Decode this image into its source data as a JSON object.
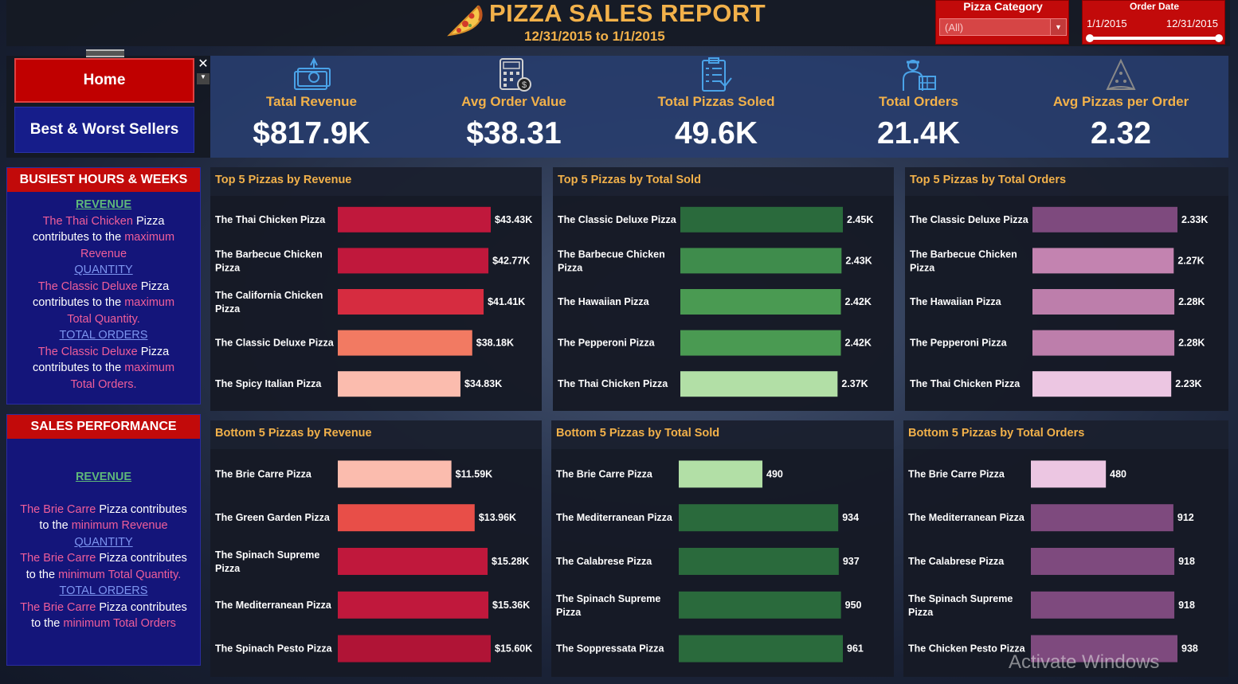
{
  "header": {
    "title": "PIZZA SALES REPORT",
    "subtitle": "12/31/2015 to 1/1/2015",
    "pizza_icon": "pizza-slice-icon"
  },
  "filters": {
    "category": {
      "label": "Pizza Category",
      "value": "(All)"
    },
    "order_date": {
      "label": "Order Date",
      "start": "1/1/2015",
      "end": "12/31/2015"
    }
  },
  "nav": {
    "home_label": "Home",
    "best_worst_label": "Best & Worst Sellers",
    "close_glyph": "✕",
    "more_glyph": "▼"
  },
  "kpis": [
    {
      "label": "Tatal Revenue",
      "value": "$817.9K",
      "icon": "money-icon"
    },
    {
      "label": "Avg Order Value",
      "value": "$38.31",
      "icon": "calculator-icon"
    },
    {
      "label": "Total Pizzas Soled",
      "value": "49.6K",
      "icon": "clipboard-icon"
    },
    {
      "label": "Total Orders",
      "value": "21.4K",
      "icon": "delivery-person-icon"
    },
    {
      "label": "Avg Pizzas per Order",
      "value": "2.32",
      "icon": "pizza-slice-icon"
    }
  ],
  "busiest": {
    "header": "BUSIEST HOURS & WEEKS",
    "revenue_head": "REVENUE",
    "rev_name": "The Thai Chicken",
    "rev_pizza": " Pizza",
    "contributes": "contributes to the",
    "maximum": "maximum",
    "revenue_word": "Revenue",
    "quantity_head": "QUANTITY",
    "qty_name": "The Classic Deluxe",
    "qty_pizza": " Pizza",
    "total_quantity": "Total Quantity.",
    "orders_head": "TOTAL ORDERS",
    "ord_name": "The Classic Deluxe",
    "ord_pizza": " Pizza",
    "total_orders": "Total Orders."
  },
  "sales_perf": {
    "header": "SALES PERFORMANCE",
    "revenue_head": "REVENUE",
    "l1a": "The Brie Carre",
    "l1b": " Pizza contributes",
    "l2a": "to the",
    "l2b": "minimum  Revenue",
    "quantity_head": "QUANTITY",
    "l3a": "The Brie Carre",
    "l3b": "  Pizza contributes",
    "l4a": "to the",
    "l4b": "minimum Total Quantity.",
    "orders_head": "TOTAL ORDERS",
    "l5a": "The Brie Carre",
    "l5b": " Pizza contributes",
    "l6a": "to the",
    "l6b": "minimum Total Orders"
  },
  "chart_data": [
    {
      "type": "bar",
      "title": "Top 5 Pizzas by Revenue",
      "categories": [
        "The Thai Chicken Pizza",
        "The Barbecue Chicken Pizza",
        "The California Chicken Pizza",
        "The Classic Deluxe Pizza",
        "The Spicy Italian Pizza"
      ],
      "values": [
        43.43,
        42.77,
        41.41,
        38.18,
        34.83
      ],
      "labels": [
        "$43.43K",
        "$42.77K",
        "$41.41K",
        "$38.18K",
        "$34.83K"
      ],
      "colors": [
        "#c0183c",
        "#c0183c",
        "#d62c40",
        "#f27a62",
        "#fbbcae"
      ],
      "xlim": [
        0,
        43.43
      ]
    },
    {
      "type": "bar",
      "title": "Top 5 Pizzas by Total Sold",
      "categories": [
        "The Classic Deluxe Pizza",
        "The Barbecue Chicken Pizza",
        "The Hawaiian Pizza",
        "The Pepperoni Pizza",
        "The Thai Chicken Pizza"
      ],
      "values": [
        2.45,
        2.43,
        2.42,
        2.42,
        2.37
      ],
      "labels": [
        "2.45K",
        "2.43K",
        "2.42K",
        "2.42K",
        "2.37K"
      ],
      "colors": [
        "#2a6a3c",
        "#3f8c4c",
        "#4a9a52",
        "#4a9a52",
        "#b2dfa6"
      ],
      "xlim": [
        0,
        2.45
      ]
    },
    {
      "type": "bar",
      "title": "Top 5 Pizzas by Total Orders",
      "categories": [
        "The Classic Deluxe Pizza",
        "The Barbecue Chicken Pizza",
        "The Hawaiian Pizza",
        "The Pepperoni Pizza",
        "The Thai Chicken Pizza"
      ],
      "values": [
        2.33,
        2.27,
        2.28,
        2.28,
        2.23
      ],
      "labels": [
        "2.33K",
        "2.27K",
        "2.28K",
        "2.28K",
        "2.23K"
      ],
      "colors": [
        "#7e4a7e",
        "#c383b0",
        "#bd7eab",
        "#bd7eab",
        "#ecc6e2"
      ],
      "xlim": [
        0,
        2.33
      ]
    },
    {
      "type": "bar",
      "title": "Bottom 5 Pizzas by Revenue",
      "categories": [
        "The Brie Carre Pizza",
        "The Green Garden Pizza",
        "The Spinach Supreme Pizza",
        "The Mediterranean Pizza",
        "The Spinach Pesto Pizza"
      ],
      "values": [
        11.59,
        13.96,
        15.28,
        15.36,
        15.6
      ],
      "labels": [
        "$11.59K",
        "$13.96K",
        "$15.28K",
        "$15.36K",
        "$15.60K"
      ],
      "colors": [
        "#fbbcae",
        "#e84e48",
        "#c0183c",
        "#c0183c",
        "#b01436"
      ],
      "xlim": [
        0,
        15.6
      ]
    },
    {
      "type": "bar",
      "title": "Bottom 5 Pizzas by Total Sold",
      "categories": [
        "The Brie Carre Pizza",
        "The Mediterranean Pizza",
        "The Calabrese Pizza",
        "The Spinach Supreme Pizza",
        "The Soppressata Pizza"
      ],
      "values": [
        490,
        934,
        937,
        950,
        961
      ],
      "labels": [
        "490",
        "934",
        "937",
        "950",
        "961"
      ],
      "colors": [
        "#b2dfa6",
        "#2a6a3c",
        "#2a6a3c",
        "#2a6a3c",
        "#2a6a3c"
      ],
      "xlim": [
        0,
        961
      ]
    },
    {
      "type": "bar",
      "title": "Bottom 5 Pizzas by Total Orders",
      "categories": [
        "The Brie Carre Pizza",
        "The Mediterranean Pizza",
        "The Calabrese Pizza",
        "The Spinach Supreme Pizza",
        "The Chicken Pesto Pizza"
      ],
      "values": [
        480,
        912,
        918,
        918,
        938
      ],
      "labels": [
        "480",
        "912",
        "918",
        "918",
        "938"
      ],
      "colors": [
        "#ecc6e2",
        "#7e4a7e",
        "#7e4a7e",
        "#7e4a7e",
        "#7e4a7e"
      ],
      "xlim": [
        0,
        938
      ]
    }
  ],
  "watermark": "Activate Windows"
}
